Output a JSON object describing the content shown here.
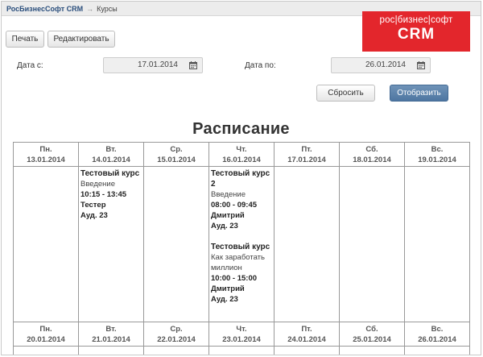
{
  "topbar": {
    "brand": "РосБизнесСофт CRM",
    "separator": "→",
    "crumb": "Курсы"
  },
  "toolbar": {
    "print_label": "Печать",
    "edit_label": "Редактировать"
  },
  "logo": {
    "line1": "рос|бизнес|софт",
    "line2": "CRM",
    "color": "#e3262c"
  },
  "filter": {
    "date_from_label": "Дата с:",
    "date_from_value": "17.01.2014",
    "date_to_label": "Дата по:",
    "date_to_value": "26.01.2014",
    "reset_label": "Сбросить",
    "show_label": "Отобразить"
  },
  "schedule_title": "Расписание",
  "week1": [
    {
      "day": "Пн.",
      "date": "13.01.2014"
    },
    {
      "day": "Вт.",
      "date": "14.01.2014"
    },
    {
      "day": "Ср.",
      "date": "15.01.2014"
    },
    {
      "day": "Чт.",
      "date": "16.01.2014"
    },
    {
      "day": "Пт.",
      "date": "17.01.2014"
    },
    {
      "day": "Сб.",
      "date": "18.01.2014"
    },
    {
      "day": "Вс.",
      "date": "19.01.2014"
    }
  ],
  "events": {
    "tue_1": {
      "name": "Тестовый курс",
      "topic": "Введение",
      "time": "10:15 - 13:45",
      "teacher": "Тестер",
      "room": "Ауд. 23"
    },
    "thu_1": {
      "name": "Тестовый курс 2",
      "topic": "Введение",
      "time": "08:00 - 09:45",
      "teacher": "Дмитрий",
      "room": "Ауд. 23"
    },
    "thu_2": {
      "name": "Тестовый курс",
      "topic": "Как заработать миллион",
      "time": "10:00 - 15:00",
      "teacher": "Дмитрий",
      "room": "Ауд. 23"
    }
  },
  "week2": [
    {
      "day": "Пн.",
      "date": "20.01.2014"
    },
    {
      "day": "Вт.",
      "date": "21.01.2014"
    },
    {
      "day": "Ср.",
      "date": "22.01.2014"
    },
    {
      "day": "Чт.",
      "date": "23.01.2014"
    },
    {
      "day": "Пт.",
      "date": "24.01.2014"
    },
    {
      "day": "Сб.",
      "date": "25.01.2014"
    },
    {
      "day": "Вс.",
      "date": "26.01.2014"
    }
  ],
  "icons": {
    "calendar": "calendar-icon"
  }
}
